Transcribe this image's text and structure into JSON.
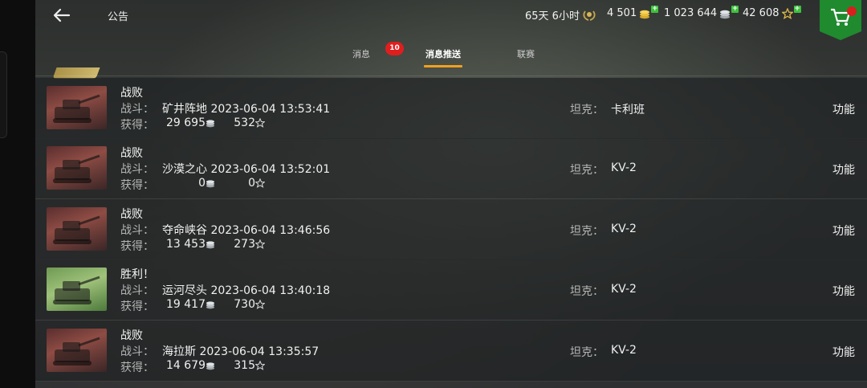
{
  "header": {
    "title": "公告",
    "premium_time": "65天 6小时",
    "gold": "4 501",
    "credits": "1 023 644",
    "free_xp": "42 608"
  },
  "tabs": [
    {
      "label": "消息",
      "badge": "10"
    },
    {
      "label": "消息推送",
      "active": true
    },
    {
      "label": "联赛"
    }
  ],
  "labels": {
    "battle": "战斗：",
    "earned": "获得：",
    "tank": "坦克：",
    "function": "功能"
  },
  "battles": [
    {
      "result": "战败",
      "map": "矿井阵地",
      "datetime": "2023-06-04 13:53:41",
      "credits": "29 695",
      "xp": "532",
      "tank": "卡利班",
      "outcome": "defeat"
    },
    {
      "result": "战败",
      "map": "沙漠之心",
      "datetime": "2023-06-04 13:52:01",
      "credits": "0",
      "xp": "0",
      "tank": "KV-2",
      "outcome": "defeat"
    },
    {
      "result": "战败",
      "map": "夺命峡谷",
      "datetime": "2023-06-04 13:46:56",
      "credits": "13 453",
      "xp": "273",
      "tank": "KV-2",
      "outcome": "defeat"
    },
    {
      "result": "胜利！",
      "map": "运河尽头",
      "datetime": "2023-06-04 13:40:18",
      "credits": "19 417",
      "xp": "730",
      "tank": "KV-2",
      "outcome": "victory"
    },
    {
      "result": "战败",
      "map": "海拉斯",
      "datetime": "2023-06-04 13:35:57",
      "credits": "14 679",
      "xp": "315",
      "tank": "KV-2",
      "outcome": "defeat"
    }
  ],
  "colors": {
    "accent": "#f0a020",
    "badge": "#e01e1e",
    "shop": "#1f8a2e",
    "plus": "#3ec13e"
  }
}
